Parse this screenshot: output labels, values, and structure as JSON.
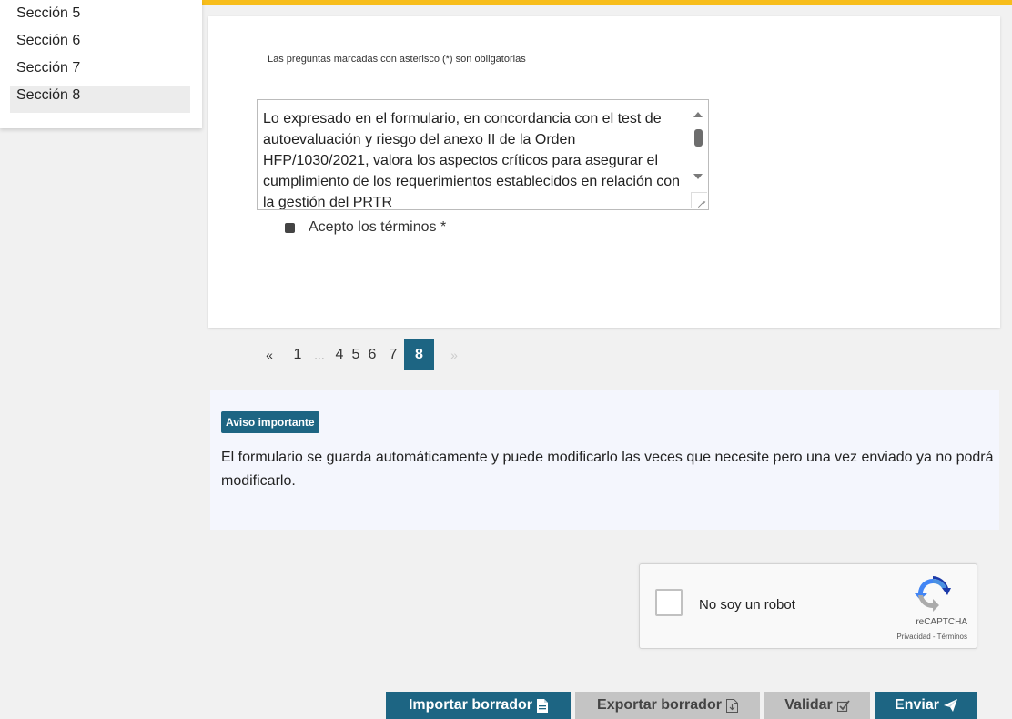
{
  "sidebar": {
    "items": [
      {
        "label": "Sección 5"
      },
      {
        "label": "Sección 6"
      },
      {
        "label": "Sección 7"
      },
      {
        "label": "Sección 8"
      }
    ]
  },
  "form": {
    "required_note": "Las preguntas marcadas con asterisco (*) son obligatorias",
    "terms_text": "Lo expresado en el formulario, en concordancia con el test de autoevaluación y riesgo del anexo II de la Orden HFP/1030/2021, valora los aspectos críticos para asegurar el cumplimiento de los requerimientos establecidos en relación con la gestión del PRTR",
    "accept_label": "Acepto los términos *"
  },
  "pagination": {
    "prev": "«",
    "first": "1",
    "dots": "...",
    "pages": [
      "4",
      "5",
      "6",
      "7"
    ],
    "current": "8",
    "next": "»"
  },
  "notice": {
    "badge": "Aviso importante",
    "text": "El formulario se guarda automáticamente y puede modificarlo las veces que necesite pero una vez enviado ya no podrá modificarlo."
  },
  "recaptcha": {
    "label": "No soy un robot",
    "brand": "reCAPTCHA",
    "links": "Privacidad - Términos"
  },
  "actions": {
    "import_label": "Importar borrador",
    "export_label": "Exportar borrador",
    "validate_label": "Validar",
    "send_label": "Enviar"
  },
  "colors": {
    "accent": "#1d6583",
    "top_bar": "#f7bd1b",
    "notice_bg": "#f4f6fd",
    "secondary_button": "#c4c4c4"
  }
}
